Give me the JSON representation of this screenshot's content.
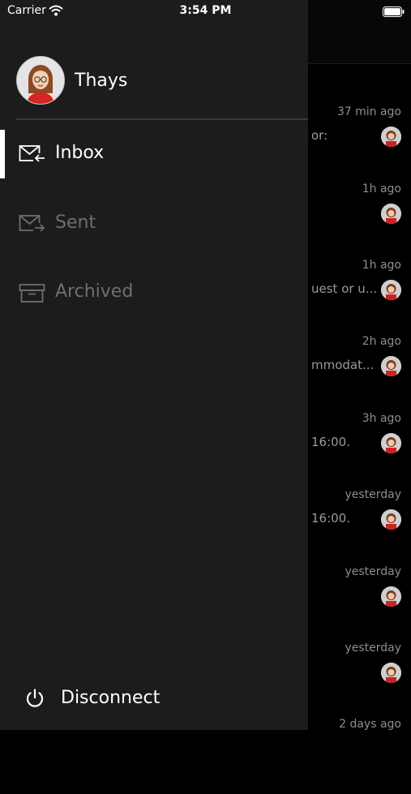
{
  "status_bar": {
    "carrier": "Carrier",
    "time": "3:54 PM"
  },
  "drawer": {
    "profile": {
      "name": "Thays"
    },
    "nav": [
      {
        "label": "Inbox",
        "icon": "inbox-icon",
        "active": true
      },
      {
        "label": "Sent",
        "icon": "sent-icon",
        "active": false
      },
      {
        "label": "Archived",
        "icon": "archive-icon",
        "active": false
      }
    ],
    "disconnect_label": "Disconnect"
  },
  "messages": [
    {
      "time": "37 min ago",
      "snippet": "or:"
    },
    {
      "time": "1h ago",
      "snippet": ""
    },
    {
      "time": "1h ago",
      "snippet": "uest or u..."
    },
    {
      "time": "2h ago",
      "snippet": "mmodat..."
    },
    {
      "time": "3h ago",
      "snippet": "16:00."
    },
    {
      "time": "yesterday",
      "snippet": "16:00."
    },
    {
      "time": "yesterday",
      "snippet": ""
    },
    {
      "time": "yesterday",
      "snippet": ""
    },
    {
      "time": "2 days ago",
      "snippet": ""
    }
  ],
  "colors": {
    "drawer_bg": "#1c1c1c",
    "active_text": "#ffffff",
    "inactive_text": "#6e6e6e",
    "indicator": "#ffffff"
  }
}
